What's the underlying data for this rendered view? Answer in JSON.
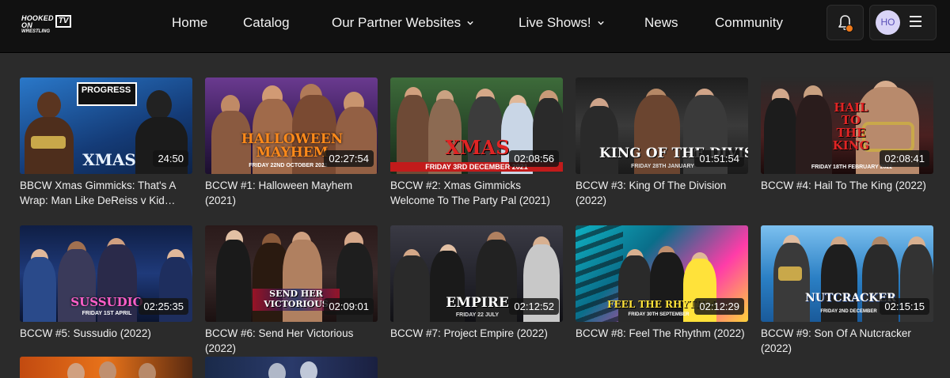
{
  "logo": {
    "line1": "HOOKED ON",
    "line2": "WRESTLING",
    "tv": "TV"
  },
  "nav": {
    "home": "Home",
    "catalog": "Catalog",
    "partners": "Our Partner Websites",
    "live": "Live Shows!",
    "news": "News",
    "community": "Community"
  },
  "user": {
    "initials": "HO"
  },
  "videos": [
    {
      "title": "BBCW Xmas Gimmicks: That's A Wrap: Man Like DeReiss v Kid Lykos II",
      "duration": "24:50",
      "overlay": "XMAS",
      "top_text": "PROGRESS",
      "accent": "#1f5fae"
    },
    {
      "title": "BCCW #1: Halloween Mayhem (2021)",
      "duration": "02:27:54",
      "overlay": "HALLOWEEN MAYHEM",
      "sub": "FRIDAY 22ND OCTOBER 2021",
      "accent": "#4a2a66"
    },
    {
      "title": "BCCW #2: Xmas Gimmicks Welcome To The Party Pal (2021)",
      "duration": "02:08:56",
      "overlay": "XMAS",
      "sub": "FRIDAY 3RD DECEMBER 2021",
      "accent": "#2f5a2f"
    },
    {
      "title": "BCCW #3: King Of The Division (2022)",
      "duration": "01:51:54",
      "overlay": "KING OF THE DIVISION",
      "sub": "FRIDAY 28TH JANUARY",
      "accent": "#333333"
    },
    {
      "title": "BCCW #4: Hail To The King (2022)",
      "duration": "02:08:41",
      "overlay": "HAIL TO THE KING",
      "sub": "FRIDAY 18TH FEBRUARY 2022",
      "accent": "#5a1a1a"
    },
    {
      "title": "BCCW #5: Sussudio (2022)",
      "duration": "02:25:35",
      "overlay": "SUSSUDIO",
      "sub": "FRIDAY 1ST APRIL",
      "accent": "#1b2b55"
    },
    {
      "title": "BCCW #6: Send Her Victorious (2022)",
      "duration": "02:09:01",
      "overlay": "SEND HER VICTORIOUS",
      "accent": "#3a1f2a"
    },
    {
      "title": "BCCW #7: Project Empire (2022)",
      "duration": "02:12:52",
      "overlay": "EMPIRE",
      "sub": "FRIDAY 22 JULY",
      "accent": "#2a2a30"
    },
    {
      "title": "BCCW #8: Feel The Rhythm (2022)",
      "duration": "02:12:29",
      "overlay": "FEEL THE RHYTHM",
      "sub": "FRIDAY 30TH SEPTEMBER",
      "accent": "#1aa7b8"
    },
    {
      "title": "BCCW #9: Son Of A Nutcracker (2022)",
      "duration": "02:15:15",
      "overlay": "NUTCRACKER",
      "sub": "FRIDAY 2ND DECEMBER",
      "accent": "#2a7fc4"
    }
  ],
  "colors": {
    "background": "#2b2b2b",
    "topbar": "#111111",
    "notification": "#f07a1a"
  }
}
